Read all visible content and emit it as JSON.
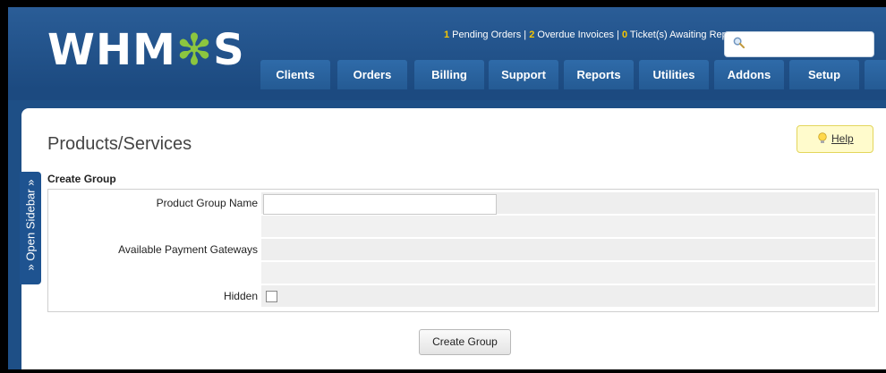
{
  "header": {
    "logo_text": "WHMCS",
    "stats": {
      "pending_count": "1",
      "pending_label": " Pending Orders | ",
      "overdue_count": "2",
      "overdue_label": " Overdue Invoices | ",
      "tickets_count": "0",
      "tickets_label": " Ticket(s) Awaiting Rep"
    },
    "search": {
      "icon": "search-icon"
    }
  },
  "nav": {
    "tabs": [
      {
        "label": "Clients"
      },
      {
        "label": "Orders"
      },
      {
        "label": "Billing"
      },
      {
        "label": "Support"
      },
      {
        "label": "Reports"
      },
      {
        "label": "Utilities"
      },
      {
        "label": "Addons"
      },
      {
        "label": "Setup"
      }
    ]
  },
  "sidebar": {
    "toggle_label": "» Open Sidebar »"
  },
  "page": {
    "title": "Products/Services",
    "help_label": "Help",
    "section_title": "Create Group"
  },
  "form": {
    "product_group_name_label": "Product Group Name",
    "product_group_name_value": "",
    "payment_gateways_label": "Available Payment Gateways",
    "hidden_label": "Hidden",
    "hidden_checked": false,
    "submit_label": "Create Group"
  },
  "colors": {
    "header_blue": "#1e4f86",
    "accent_yellow": "#f7c600",
    "logo_gear": "#8cc63f"
  }
}
